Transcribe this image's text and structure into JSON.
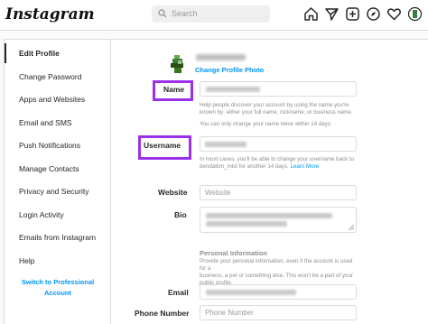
{
  "app": {
    "logo": "Instagram"
  },
  "search": {
    "placeholder": "Search"
  },
  "nav_icons": [
    "home-icon",
    "direct-message-icon",
    "new-post-icon",
    "explore-icon",
    "heart-icon",
    "profile-avatar-icon"
  ],
  "sidebar": {
    "items": [
      {
        "label": "Edit Profile",
        "active": true
      },
      {
        "label": "Change Password"
      },
      {
        "label": "Apps and Websites"
      },
      {
        "label": "Email and SMS"
      },
      {
        "label": "Push Notifications"
      },
      {
        "label": "Manage Contacts"
      },
      {
        "label": "Privacy and Security"
      },
      {
        "label": "Login Activity"
      },
      {
        "label": "Emails from Instagram"
      },
      {
        "label": "Help"
      }
    ],
    "switch_line1": "Switch to Professional",
    "switch_line2": "Account"
  },
  "profile": {
    "change_photo": "Change Profile Photo"
  },
  "form": {
    "name_label": "Name",
    "name_help1": "Help people discover your account by using the name you're",
    "name_help2": "known by: either your full name, nickname, or business name.",
    "name_help3": "You can only change your name twice within 14 days.",
    "username_label": "Username",
    "username_help1": "In most cases, you'll be able to change your username back to",
    "username_help2_prefix": "dendation_mist for another 14 days.",
    "username_help_link": "Learn More",
    "website_label": "Website",
    "website_placeholder": "Website",
    "bio_label": "Bio",
    "personal_info_title": "Personal Information",
    "personal_help1": "Provide your personal information, even if the account is used for a",
    "personal_help2": "business, a pet or something else. This won't be a part of your",
    "personal_help3": "public profile.",
    "email_label": "Email",
    "phone_label": "Phone Number",
    "phone_placeholder": "Phone Number"
  },
  "colors": {
    "highlight": "#9b30e8",
    "link": "#0095f6",
    "border": "#dbdbdb"
  }
}
